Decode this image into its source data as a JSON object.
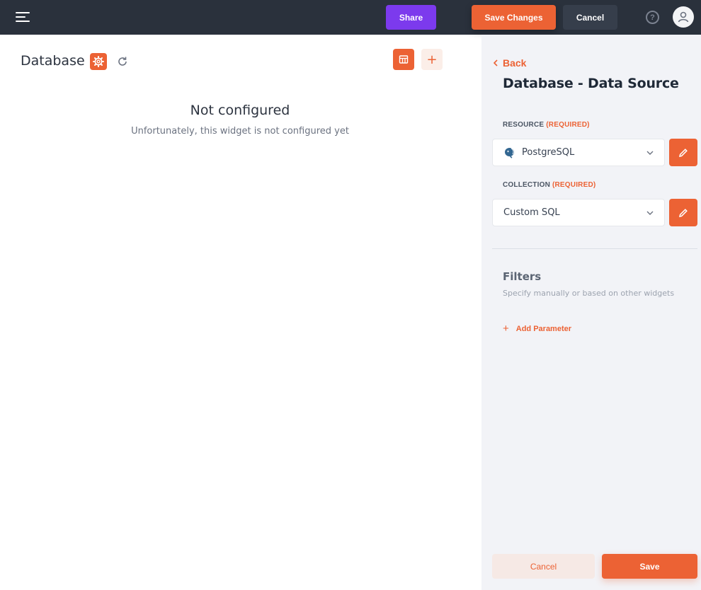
{
  "topbar": {
    "menu_icon": "hamburger-icon",
    "share_label": "Share",
    "save_changes_label": "Save Changes",
    "cancel_label": "Cancel",
    "help_icon": "question-circle-icon",
    "help_glyph": "?",
    "avatar_icon": "user-avatar-icon"
  },
  "widget": {
    "title": "Database",
    "settings_icon": "gear-icon",
    "refresh_icon": "refresh-icon",
    "table_icon": "table-icon",
    "add_icon": "plus-icon",
    "add_glyph": "+",
    "empty_title": "Not configured",
    "empty_subtitle": "Unfortunately, this widget is not configured yet"
  },
  "panel": {
    "back_label": "Back",
    "title": "Database - Data Source",
    "resource_label": "RESOURCE",
    "resource_required": "(REQUIRED)",
    "resource_value": "PostgreSQL",
    "collection_label": "COLLECTION",
    "collection_required": "(REQUIRED)",
    "collection_value": "Custom SQL",
    "filters_title": "Filters",
    "filters_subtitle": "Specify manually or based on other widgets",
    "add_parameter_label": "Add Parameter",
    "add_parameter_glyph": "+",
    "cancel_label": "Cancel",
    "save_label": "Save"
  },
  "colors": {
    "accent": "#ec6234",
    "share": "#7c3aed",
    "topbar": "#2a313c",
    "panel_bg": "#f2f3f7"
  }
}
